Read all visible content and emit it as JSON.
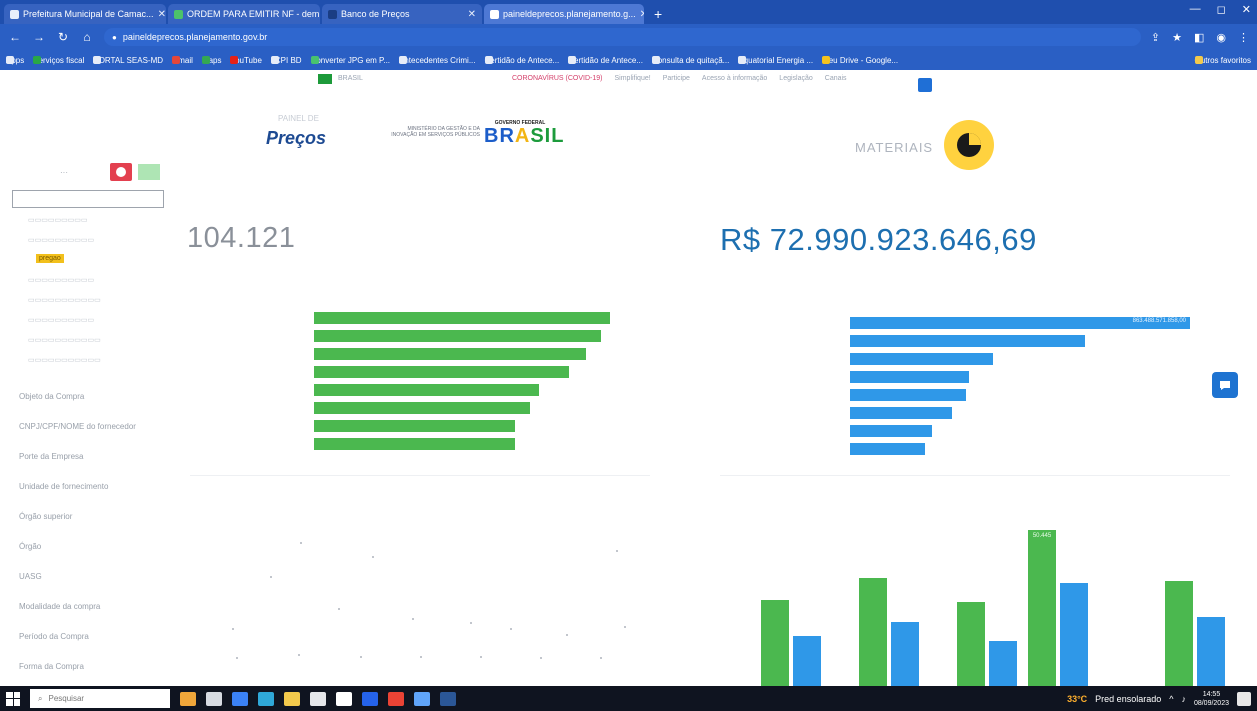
{
  "browser": {
    "tabs": [
      {
        "label": "Prefeitura Municipal de Camac..."
      },
      {
        "label": "ORDEM PARA EMITIR NF - dem..."
      },
      {
        "label": "Banco de Preços"
      },
      {
        "label": "paineldeprecos.planejamento.g...",
        "active": true
      }
    ],
    "new_tab": "+",
    "window_controls": [
      "—",
      "◻",
      "✕"
    ],
    "url": "paineldeprecos.planejamento.gov.br",
    "bookmarks": [
      "Apps",
      "Serviços fiscal",
      "PORTAL SEAS-MD",
      "Gmail",
      "Maps",
      "YouTube",
      "JCPI BD",
      "Converter JPG em P...",
      "Antecedentes Crimi...",
      "Certidão de Antece...",
      "Certidão de Antece...",
      "Consulta de quitaçã...",
      "Equatorial Energia ...",
      "Meu Drive - Google..."
    ],
    "bookmarks_right": "Outros favoritos"
  },
  "govbar": {
    "brasil": "BRASIL",
    "links": [
      "CORONAVÍRUS (COVID-19)",
      "Simplifique!",
      "Participe",
      "Acesso à informação",
      "Legislação",
      "Canais"
    ]
  },
  "header": {
    "brand_small": "PAINEL DE",
    "brand": "Preços",
    "ministry": "MINISTÉRIO DA GESTÃO E DA INOVAÇÃO EM SERVIÇOS PÚBLICOS",
    "gov_top": "GOVERNO FEDERAL",
    "gov_word": [
      "BR",
      "A",
      "SIL"
    ],
    "section": "MATERIAIS"
  },
  "filters": {
    "pregao_tag": "pregao",
    "items": [
      "Objeto da Compra",
      "CNPJ/CPF/NOME do fornecedor",
      "Porte da Empresa",
      "Unidade de fornecimento",
      "Órgão superior",
      "Órgão",
      "UASG",
      "Modalidade da compra",
      "Período da Compra",
      "Forma da Compra"
    ]
  },
  "kpis": {
    "count": "104.121",
    "value": "R$ 72.990.923.646,69"
  },
  "chart_data": [
    {
      "type": "bar",
      "orientation": "horizontal",
      "color": "#4bb84f",
      "values_relative": [
        1.0,
        0.97,
        0.92,
        0.86,
        0.76,
        0.73,
        0.68,
        0.68
      ]
    },
    {
      "type": "bar",
      "orientation": "horizontal",
      "color": "#2f98e8",
      "top_label": "863.488.571.858,00",
      "values_relative": [
        1.0,
        0.69,
        0.42,
        0.35,
        0.34,
        0.3,
        0.24,
        0.22
      ]
    },
    {
      "type": "bar",
      "orientation": "vertical",
      "series": [
        {
          "color": "#4bb84f",
          "values_relative": [
            0.55,
            0.69,
            0.54,
            1.0,
            0.67
          ]
        },
        {
          "color": "#2f98e8",
          "values_relative": [
            0.32,
            0.41,
            0.29,
            0.66,
            0.44
          ]
        }
      ],
      "peak_label": "50.445"
    }
  ],
  "taskbar": {
    "search_placeholder": "Pesquisar",
    "weather": "33°C",
    "weather_text": "Pred ensolarado",
    "time": "14:55",
    "date": "08/09/2023"
  }
}
